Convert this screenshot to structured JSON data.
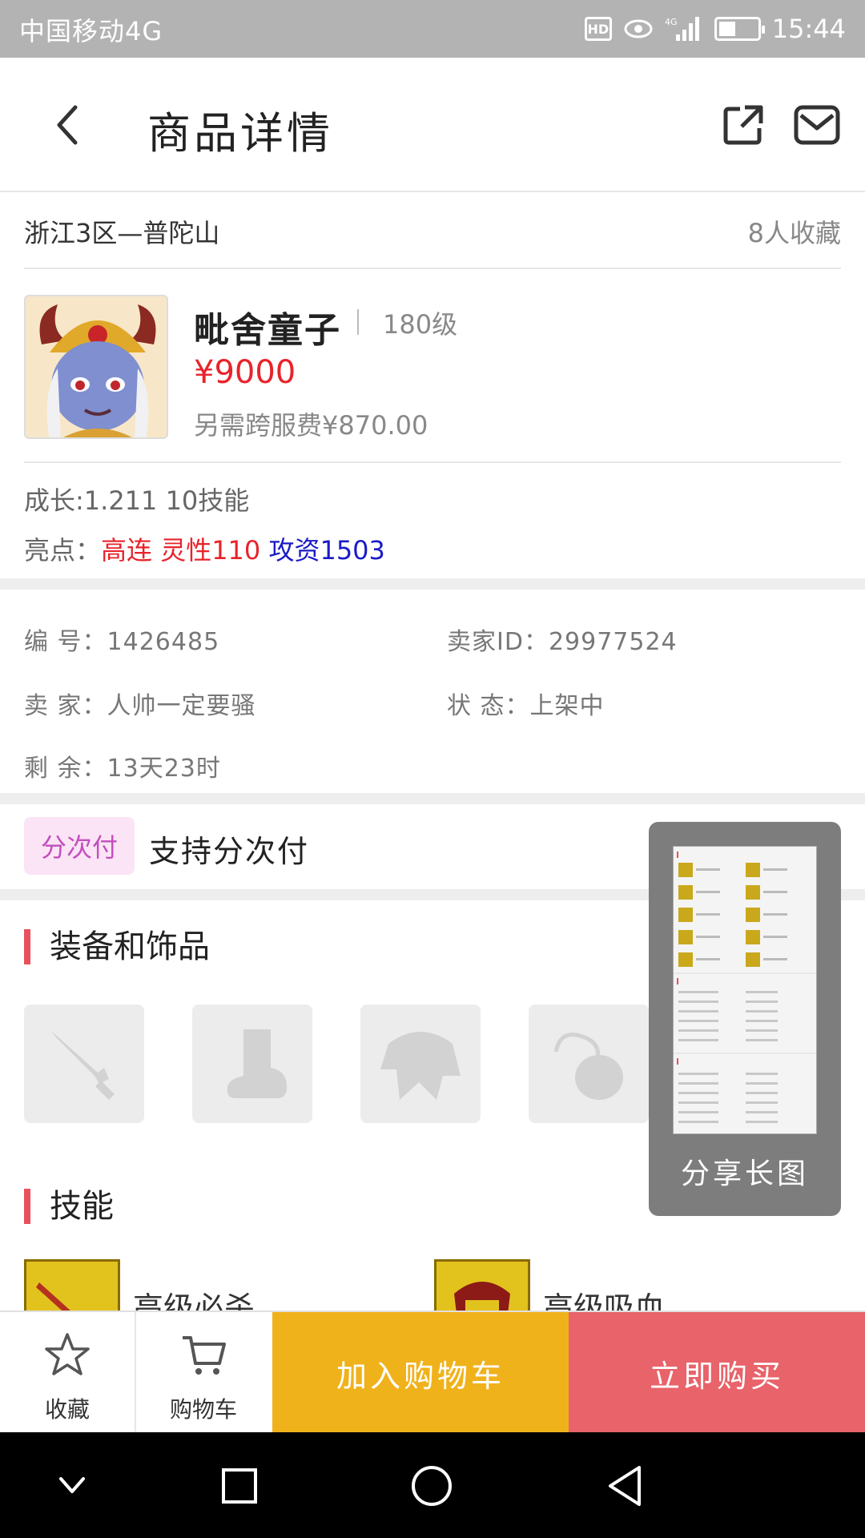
{
  "status_bar": {
    "carrier": "中国移动4G",
    "hd": "HD",
    "time": "15:44"
  },
  "header": {
    "title": "商品详情"
  },
  "server": {
    "name": "浙江3区—普陀山",
    "favorites": "8人收藏"
  },
  "product": {
    "name": "毗舍童子",
    "level": "180级",
    "price": "¥9000",
    "extra_fee": "另需跨服费¥870.00"
  },
  "attributes": {
    "growth": "成长:1.211 10技能",
    "highlights_label": "亮点：",
    "highlight_red": "高连 灵性110",
    "highlight_blue": "攻资1503"
  },
  "info": {
    "id_label": "编  号：",
    "id_value": "1426485",
    "seller_id_label": "卖家ID：",
    "seller_id_value": "29977524",
    "seller_label": "卖  家：",
    "seller_value": "人帅一定要骚",
    "status_label": "状  态：",
    "status_value": "上架中",
    "remaining_label": "剩  余：",
    "remaining_value": "13天23时"
  },
  "installment": {
    "tag": "分次付",
    "text": "支持分次付"
  },
  "sections": {
    "equipment": "装备和饰品",
    "skills": "技能"
  },
  "equipment": [
    {
      "icon": "sword-icon"
    },
    {
      "icon": "boot-icon"
    },
    {
      "icon": "armor-icon"
    },
    {
      "icon": "necklace-icon"
    }
  ],
  "skills": [
    {
      "name": "高级必杀",
      "icon": "sword-skill-icon"
    },
    {
      "name": "高级吸血",
      "icon": "vampire-skill-icon"
    }
  ],
  "share_popup": {
    "label": "分享长图"
  },
  "bottom_bar": {
    "favorite": "收藏",
    "cart": "购物车",
    "add_to_cart": "加入购物车",
    "buy_now": "立即购买"
  },
  "colors": {
    "price_red": "#e8232b",
    "highlight_blue": "#1a1ac8",
    "cart_button": "#f0b21b",
    "buy_button": "#e8636a",
    "section_accent": "#e8505b"
  }
}
